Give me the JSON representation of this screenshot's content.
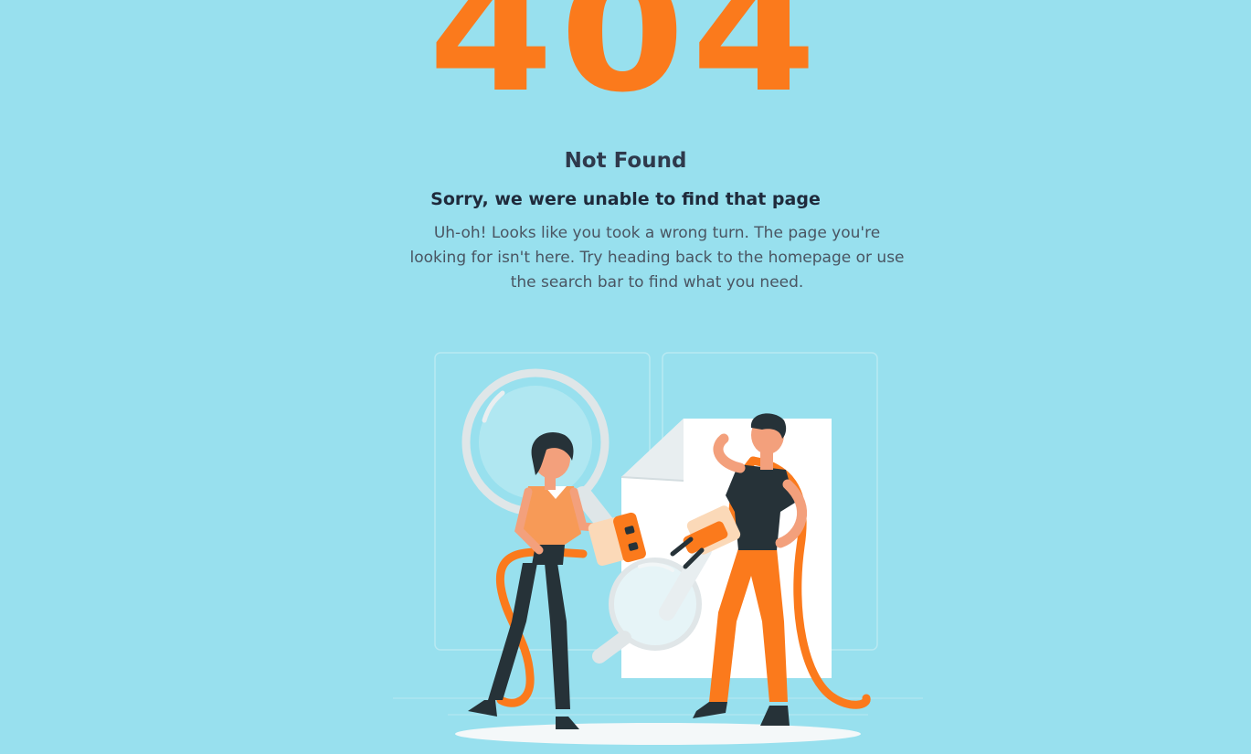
{
  "error": {
    "code": "404",
    "status": "Not Found",
    "heading": "Sorry, we were unable to find that page",
    "message": "Uh-oh! Looks like you took a wrong turn. The page you're looking for isn't here. Try heading back to the homepage or use the search bar to find what you need."
  },
  "colors": {
    "background": "#98e0ee",
    "accent": "#fb7a1c",
    "text_dark": "#2f3a4c"
  },
  "illustration": {
    "name": "people-with-unplugged-cable-illustration"
  }
}
